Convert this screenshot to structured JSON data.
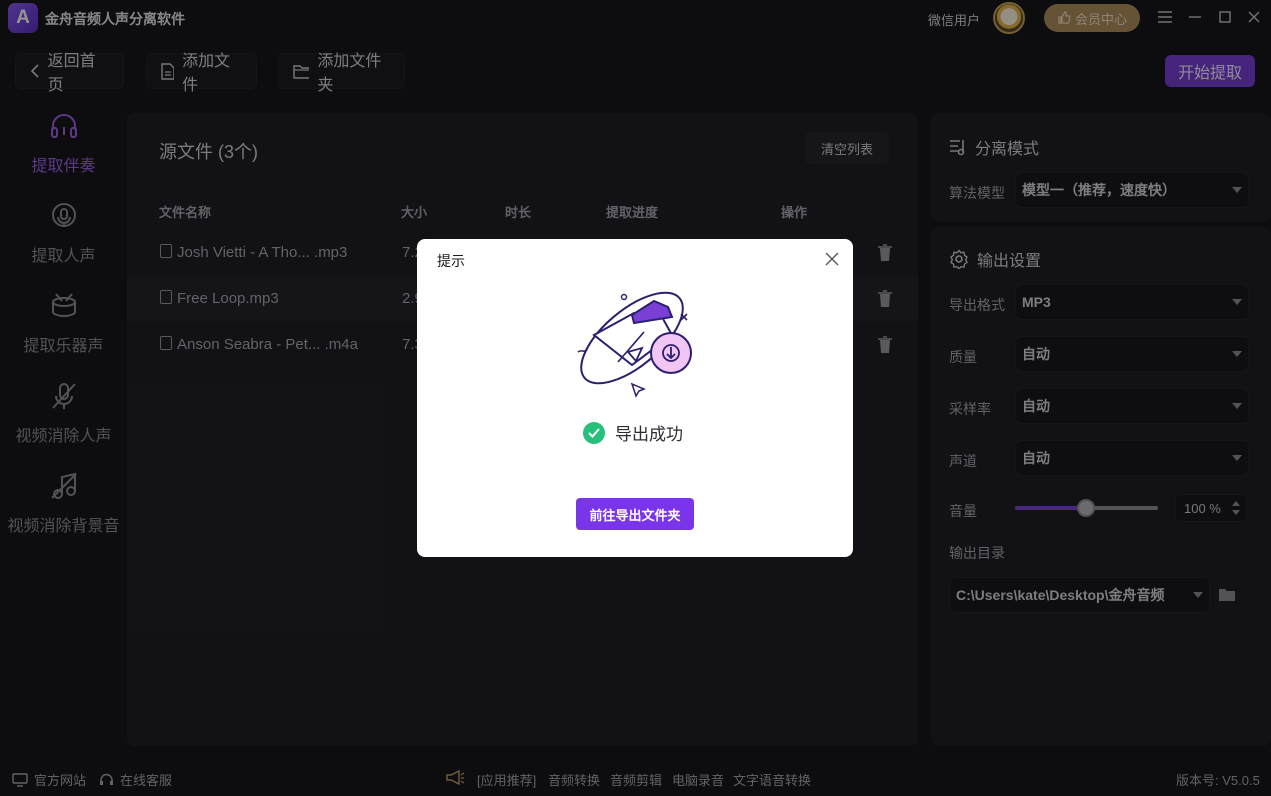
{
  "titlebar": {
    "app_title": "金舟音频人声分离软件",
    "logo_letter": "A",
    "user_label": "微信用户",
    "vip_label": "会员中心"
  },
  "toolbar": {
    "back_label": "返回首页",
    "add_file_label": "添加文件",
    "add_folder_label": "添加文件夹",
    "start_label": "开始提取"
  },
  "nav": {
    "items": [
      {
        "label": "提取伴奏",
        "icon": "headphone-icon",
        "active": true
      },
      {
        "label": "提取人声",
        "icon": "vocal-icon",
        "active": false
      },
      {
        "label": "提取乐器声",
        "icon": "drum-icon",
        "active": false
      },
      {
        "label": "视频消除人声",
        "icon": "mute-mic-icon",
        "active": false
      },
      {
        "label": "视频消除背景音",
        "icon": "mute-music-icon",
        "active": false
      }
    ]
  },
  "files": {
    "title": "源文件 (3个)",
    "clear_label": "清空列表",
    "columns": [
      "文件名称",
      "大小",
      "时长",
      "提取进度",
      "操作"
    ],
    "rows": [
      {
        "name": "Josh Vietti - A Tho... .mp3",
        "size": "7.2"
      },
      {
        "name": "Free Loop.mp3",
        "size": "2.9"
      },
      {
        "name": "Anson Seabra - Pet... .m4a",
        "size": "7.3"
      }
    ]
  },
  "separation": {
    "title": "分离模式",
    "model_label": "算法模型",
    "model_value": "模型一（推荐，速度快）"
  },
  "output": {
    "title": "输出设置",
    "format_label": "导出格式",
    "format_value": "MP3",
    "quality_label": "质量",
    "quality_value": "自动",
    "samplerate_label": "采样率",
    "samplerate_value": "自动",
    "channel_label": "声道",
    "channel_value": "自动",
    "volume_label": "音量",
    "volume_value": "100 %",
    "volume_level": 0.5,
    "dir_label": "输出目录",
    "dir_value": "C:\\Users\\kate\\Desktop\\金舟音频"
  },
  "footer": {
    "website_label": "官方网站",
    "service_label": "在线客服",
    "recommend_label": "[应用推荐]",
    "links": [
      "音频转换",
      "音频剪辑",
      "电脑录音",
      "文字语音转换"
    ],
    "version_label": "版本号: V5.0.5"
  },
  "dialog": {
    "title": "提示",
    "message": "导出成功",
    "button_label": "前往导出文件夹"
  },
  "colors": {
    "accent": "#7a3fd4",
    "background": "#17171d",
    "panel": "#1f1f27",
    "success": "#27c07a"
  }
}
